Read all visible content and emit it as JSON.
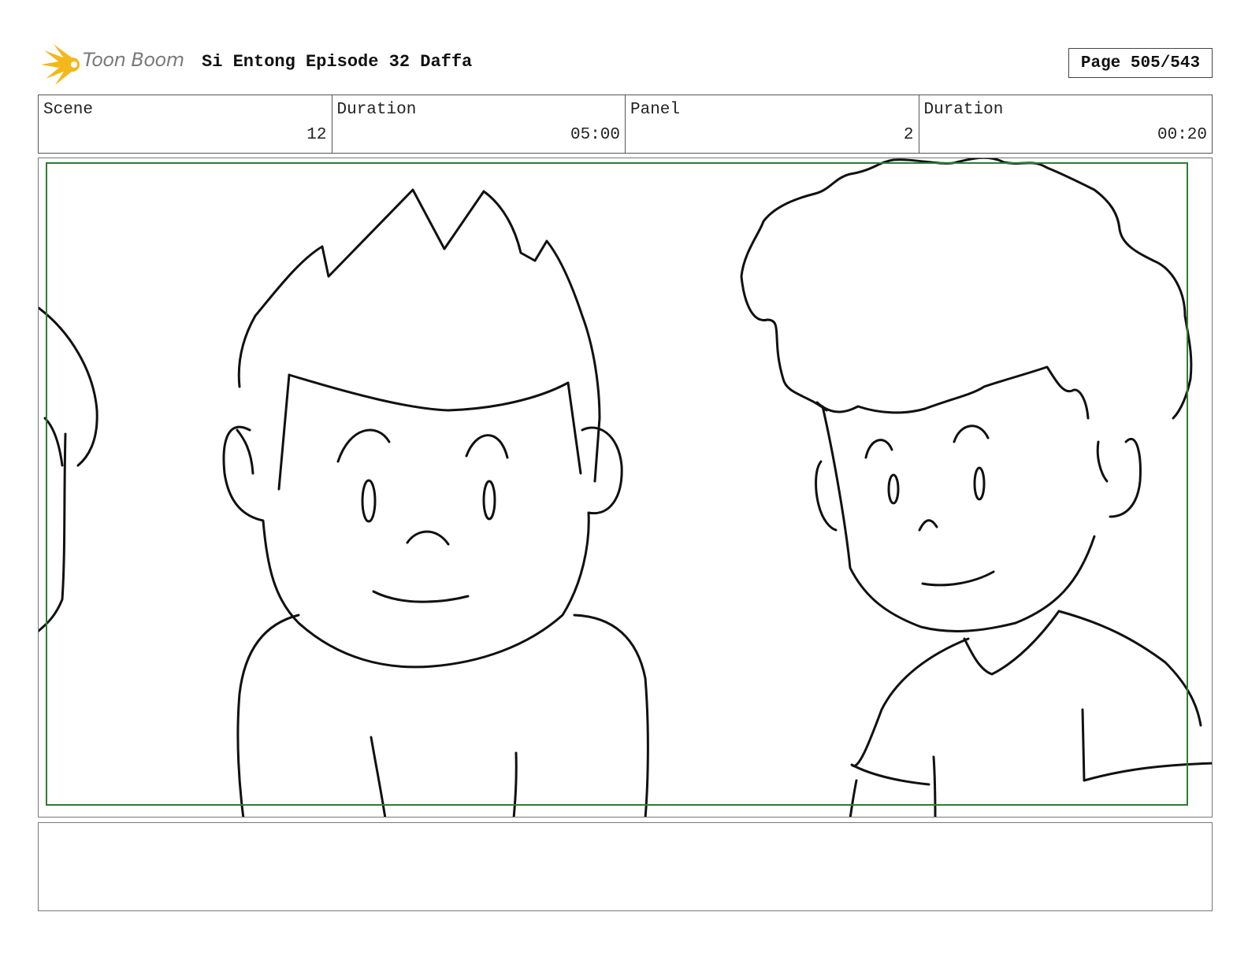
{
  "header": {
    "logo_text": "Toon Boom",
    "title": "Si Entong Episode 32 Daffa",
    "page": "Page 505/543"
  },
  "info": {
    "scene_label": "Scene",
    "scene_value": "12",
    "scene_duration_label": "Duration",
    "scene_duration_value": "05:00",
    "panel_label": "Panel",
    "panel_value": "2",
    "panel_duration_label": "Duration",
    "panel_duration_value": "00:20"
  },
  "colors": {
    "logo_accent": "#f2b81c",
    "safe_frame": "#2e7d32",
    "ink": "#111111"
  }
}
